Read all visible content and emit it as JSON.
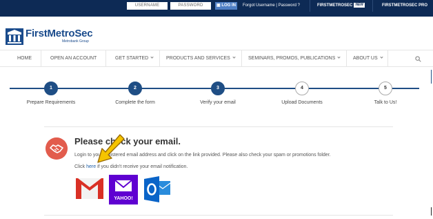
{
  "topbar": {
    "username_placeholder": "USERNAME",
    "password_placeholder": "PASSWORD",
    "login_label": "LOG IN",
    "forgot_label": "Forgot Username | Password ?",
    "platform1_label": "FIRSTMETROSEC",
    "platform1_badge": "NEW",
    "platform2_label": "FIRSTMETROSEC PRO"
  },
  "logo": {
    "name": "FirstMetroSec",
    "subtitle": "Metrobank Group"
  },
  "nav": {
    "items": [
      {
        "label": "HOME"
      },
      {
        "label": "OPEN AN ACCOUNT"
      },
      {
        "label": "GET STARTED"
      },
      {
        "label": "PRODUCTS AND SERVICES"
      },
      {
        "label": "SEMINARS, PROMOS, PUBLICATIONS"
      },
      {
        "label": "ABOUT US"
      }
    ]
  },
  "steps": [
    {
      "number": "1",
      "label": "Prepare Requirements",
      "status": "complete"
    },
    {
      "number": "2",
      "label": "Complete the form",
      "status": "complete"
    },
    {
      "number": "3",
      "label": "Verify your email",
      "status": "current"
    },
    {
      "number": "4",
      "label": "Upload Documents",
      "status": "pending"
    },
    {
      "number": "5",
      "label": "Talk to Us!",
      "status": "pending"
    }
  ],
  "content": {
    "heading": "Please check your email.",
    "instruction": "Login to your registered email address and click on the link provided. Please also check your spam or promotions folder.",
    "resend_prefix": "Click ",
    "resend_link": "here",
    "resend_suffix": " if you didn't receive your email notification.",
    "yahoo_label": "YAHOO!"
  },
  "colors": {
    "topbar": "#0d2a55",
    "accent": "#1f4e85",
    "login_button": "#4f7fc5",
    "hand_icon_bg": "#e25c4d",
    "gmail_red": "#d93025",
    "yahoo_purple": "#5f01d1",
    "outlook_blue": "#0a64c8",
    "arrow_yellow": "#f5c400"
  }
}
